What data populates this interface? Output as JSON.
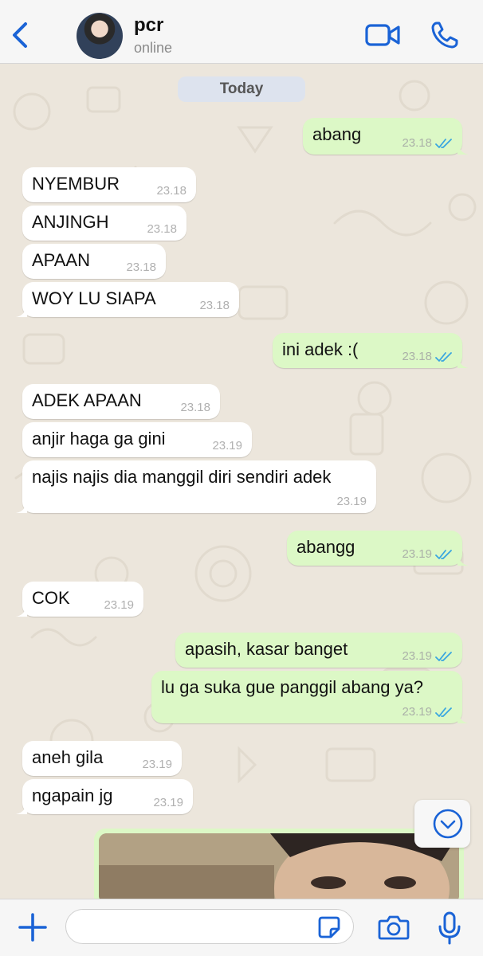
{
  "header": {
    "contact_name": "pcr",
    "status": "online"
  },
  "chat": {
    "date_label": "Today",
    "messages": [
      {
        "dir": "out",
        "text": "abang",
        "time": "23.18",
        "read": true
      },
      {
        "dir": "in",
        "text": "NYEMBUR",
        "time": "23.18"
      },
      {
        "dir": "in",
        "text": "ANJINGH",
        "time": "23.18"
      },
      {
        "dir": "in",
        "text": "APAAN",
        "time": "23.18"
      },
      {
        "dir": "in",
        "text": "WOY LU SIAPA",
        "time": "23.18"
      },
      {
        "dir": "out",
        "text": "ini adek :(",
        "time": "23.18",
        "read": true
      },
      {
        "dir": "in",
        "text": "ADEK APAAN",
        "time": "23.18"
      },
      {
        "dir": "in",
        "text": "anjir haga ga gini",
        "time": "23.19"
      },
      {
        "dir": "in",
        "text": "najis najis dia manggil diri sendiri adek",
        "time": "23.19"
      },
      {
        "dir": "out",
        "text": "abangg",
        "time": "23.19",
        "read": true
      },
      {
        "dir": "in",
        "text": "COK",
        "time": "23.19"
      },
      {
        "dir": "out",
        "text": "apasih, kasar banget",
        "time": "23.19",
        "read": true
      },
      {
        "dir": "out",
        "text": "lu ga suka gue panggil abang ya?",
        "time": "23.19",
        "read": true
      },
      {
        "dir": "in",
        "text": "aneh gila",
        "time": "23.19"
      },
      {
        "dir": "in",
        "text": "ngapain jg",
        "time": "23.19"
      }
    ]
  },
  "input": {
    "placeholder": "",
    "value": ""
  },
  "colors": {
    "accent": "#1a63d6",
    "outgoing_bubble": "#dcf8c6",
    "incoming_bubble": "#ffffff",
    "read_ticks": "#3aa6e0",
    "chat_background": "#ece6dc"
  }
}
